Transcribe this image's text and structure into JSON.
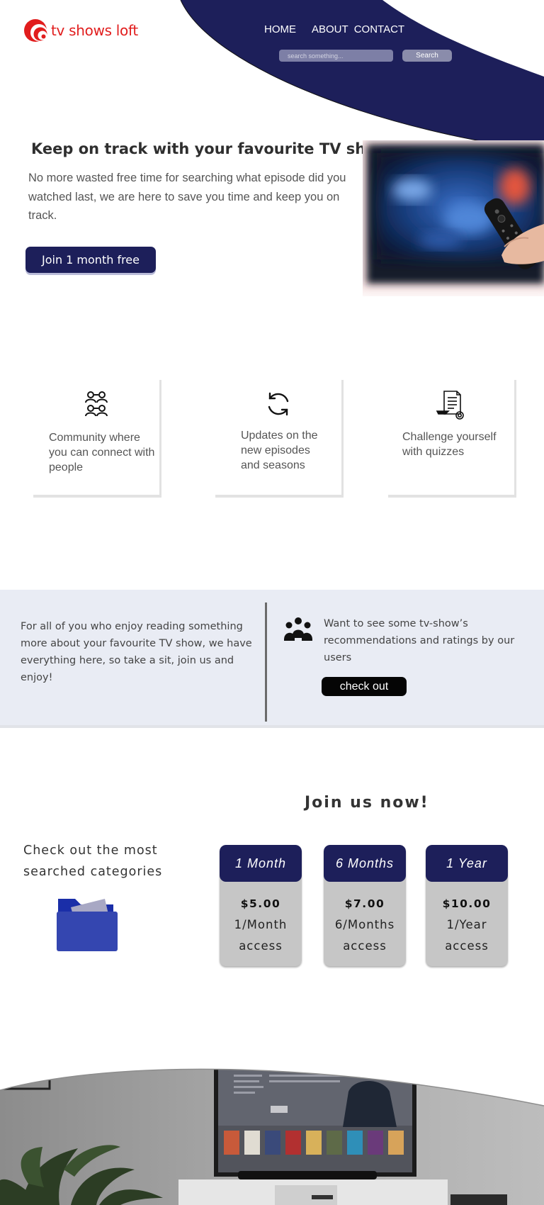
{
  "brand": {
    "name": "tv shows loft",
    "color": "#e11d1d"
  },
  "nav": [
    {
      "label": "HOME"
    },
    {
      "label": "ABOUT"
    },
    {
      "label": "CONTACT"
    }
  ],
  "search": {
    "placeholder": "search something...",
    "button_label": "Search"
  },
  "hero": {
    "title": "Keep on track with your favourite TV show",
    "text": "No more wasted free time for searching what episode did you watched last, we are here to save you time and keep you on track.",
    "cta_label": "Join 1 month free"
  },
  "features": [
    {
      "icon": "community-icon",
      "text": "Community where you can connect with people"
    },
    {
      "icon": "refresh-icon",
      "text": "Updates on the new episodes and seasons"
    },
    {
      "icon": "quiz-icon",
      "text": "Challenge yourself with quizzes"
    }
  ],
  "info": {
    "left_text": "For all of you who enjoy reading something more about your favourite TV show, we have everything here, so take a sit, join us and enjoy!",
    "right_text": "Want to see some tv-show’s recommendations and ratings by our users",
    "button_label": "check out",
    "icon": "people-group-icon"
  },
  "pricing": {
    "title": "Join us now!",
    "categories_text": "Check out the most searched categories",
    "categories_icon": "folder-icon",
    "plans": [
      {
        "name": "1 Month",
        "price": "$5.00",
        "access": "1/Month access"
      },
      {
        "name": "6 Months",
        "price": "$7.00",
        "access": "6/Months access"
      },
      {
        "name": "1 Year",
        "price": "$10.00",
        "access": "1/Year access"
      }
    ]
  },
  "colors": {
    "navy": "#1d1f5a",
    "band": "#e9ecf4",
    "plan_body": "#c6c6c6",
    "button_dark": "#050505"
  }
}
